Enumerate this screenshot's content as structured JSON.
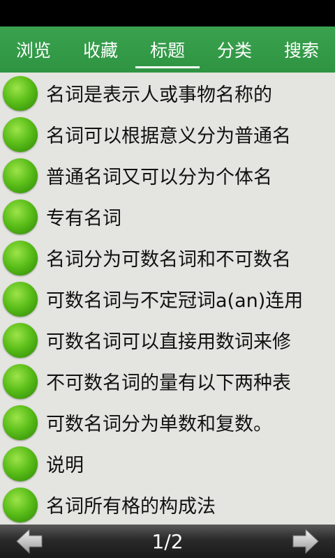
{
  "tabs": [
    {
      "label": "浏览",
      "active": false
    },
    {
      "label": "收藏",
      "active": false
    },
    {
      "label": "标题",
      "active": true
    },
    {
      "label": "分类",
      "active": false
    },
    {
      "label": "搜索",
      "active": false
    }
  ],
  "list": {
    "items": [
      "名词是表示人或事物名称的",
      "名词可以根据意义分为普通名",
      "普通名词又可以分为个体名",
      "专有名词",
      "名词分为可数名词和不可数名",
      "可数名词与不定冠词a(an)连用",
      "可数名词可以直接用数词来修",
      "不可数名词的量有以下两种表",
      "可数名词分为单数和复数。",
      "说明",
      "名词所有格的构成法"
    ]
  },
  "pager": {
    "page": "1/2",
    "prev_icon": "arrow-left-icon",
    "next_icon": "arrow-right-icon"
  },
  "colors": {
    "tab_bar": "#2e9442",
    "list_bg": "#e4e4e0",
    "dot": "#5cbf1a"
  }
}
